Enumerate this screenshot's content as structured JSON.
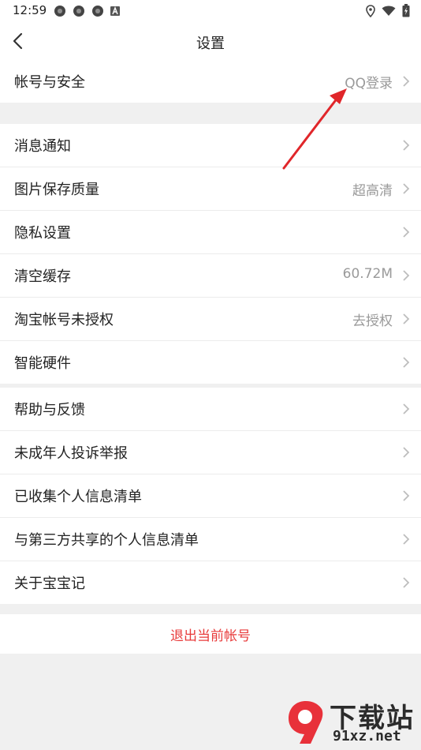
{
  "status_bar": {
    "time": "12:59",
    "left_icons": [
      "app-notification-icon",
      "app-notification-icon",
      "app-notification-icon",
      "a-badge-icon"
    ],
    "right_icons": [
      "location-icon",
      "wifi-icon",
      "battery-icon"
    ]
  },
  "header": {
    "title": "设置",
    "back_icon": "chevron-left-icon"
  },
  "groups": [
    {
      "items": [
        {
          "label": "帐号与安全",
          "value": "QQ登录"
        }
      ]
    },
    {
      "items": [
        {
          "label": "消息通知",
          "value": ""
        },
        {
          "label": "图片保存质量",
          "value": "超高清"
        },
        {
          "label": "隐私设置",
          "value": ""
        },
        {
          "label": "清空缓存",
          "value": "60.72M"
        },
        {
          "label": "淘宝帐号未授权",
          "value": "去授权"
        },
        {
          "label": "智能硬件",
          "value": ""
        }
      ]
    },
    {
      "items": [
        {
          "label": "帮助与反馈",
          "value": ""
        },
        {
          "label": "未成年人投诉举报",
          "value": ""
        },
        {
          "label": "已收集个人信息清单",
          "value": ""
        },
        {
          "label": "与第三方共享的个人信息清单",
          "value": ""
        },
        {
          "label": "关于宝宝记",
          "value": ""
        }
      ]
    }
  ],
  "logout": {
    "label": "退出当前帐号"
  },
  "watermark": {
    "top": "下载站",
    "bottom": "91xz.net"
  },
  "colors": {
    "accent_red": "#e83b3b",
    "annotation_arrow": "#e0262a",
    "value_gray": "#9a9a9a",
    "background": "#f0f0f0"
  }
}
